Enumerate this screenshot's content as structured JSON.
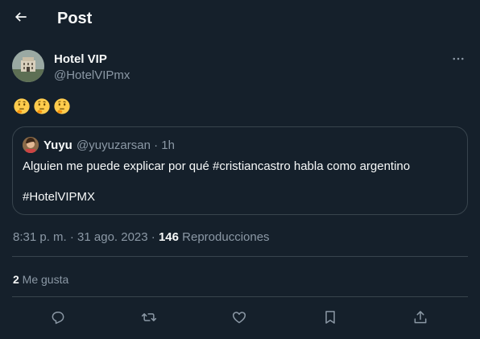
{
  "header": {
    "title": "Post",
    "back_icon": "back-arrow-icon"
  },
  "post": {
    "author": {
      "name": "Hotel VIP",
      "handle": "@HotelVIPmx"
    },
    "more_icon": "more-icon",
    "emojis": [
      "🤔",
      "🤔",
      "🤔"
    ],
    "quote": {
      "author_name": "Yuyu",
      "author_handle": "@yuyuzarsan · 1h",
      "text": "Alguien me puede explicar por qué #cristiancastro habla como argentino",
      "hashtag": "#HotelVIPMX"
    },
    "time": "8:31 p. m. · 31 ago. 2023 · ",
    "views_count": "146",
    "views_label": " Reproducciones",
    "likes_count": "2",
    "likes_label": " Me gusta"
  },
  "actions": [
    "reply-icon",
    "retweet-icon",
    "like-icon",
    "bookmark-icon",
    "share-icon"
  ],
  "colors": {
    "background": "#15202b",
    "text": "#f7f9f9",
    "secondary": "#8b98a5",
    "border": "#38444d",
    "emoji": "#ffcc4d"
  }
}
